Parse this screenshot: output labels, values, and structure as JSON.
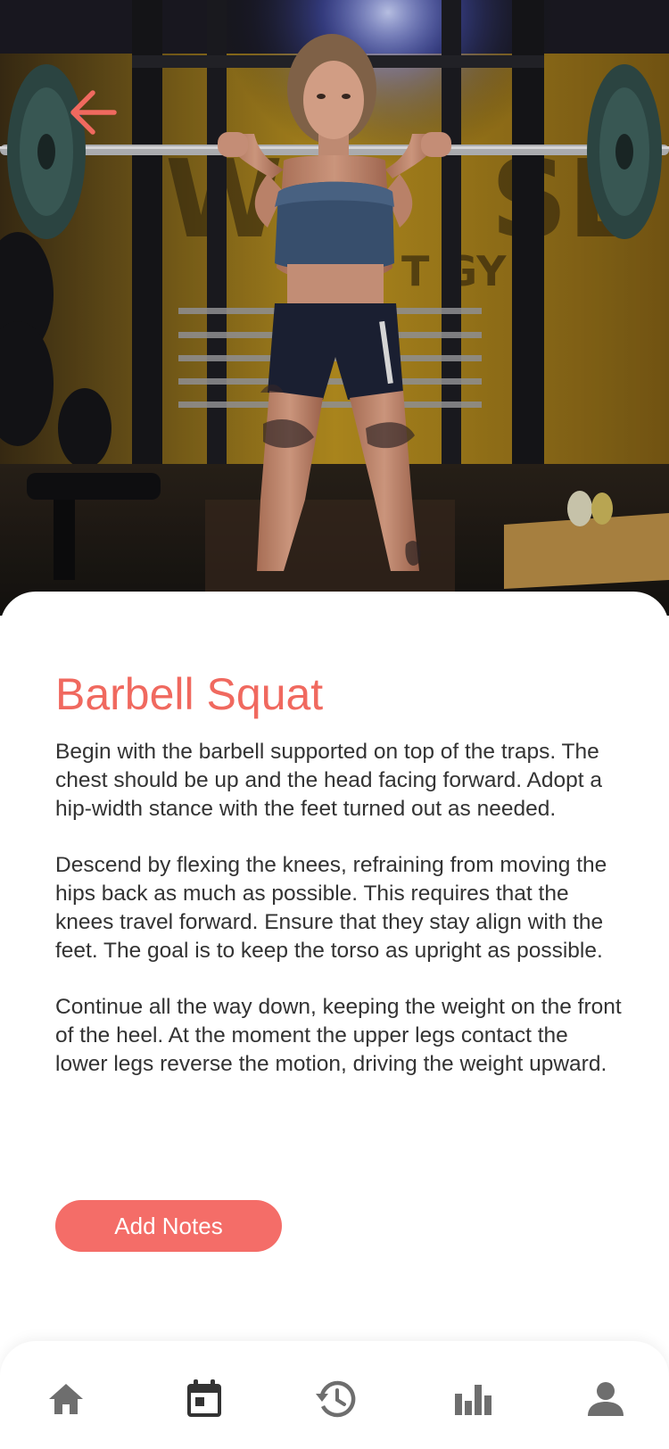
{
  "exercise": {
    "title": "Barbell Squat",
    "paragraphs": [
      "Begin with the barbell supported on top of the traps. The chest should be up and the head facing forward. Adopt a hip-width stance with the feet turned out as needed.",
      "Descend by flexing the knees, refraining from moving the hips back as much as possible. This requires that the knees travel forward. Ensure that they stay align with the feet. The goal is to keep the torso as upright as possible.",
      "Continue all the way down, keeping the weight on the front of the heel. At the moment the upper legs contact the lower legs reverse the motion, driving the weight upward."
    ],
    "add_notes_label": "Add Notes"
  },
  "hero": {
    "back_icon": "arrow-left-icon",
    "image_subject": "athlete-barbell-squat-photo"
  },
  "tabbar": {
    "items": [
      {
        "icon": "home-icon",
        "active": false
      },
      {
        "icon": "calendar-icon",
        "active": true
      },
      {
        "icon": "history-icon",
        "active": false
      },
      {
        "icon": "bar-chart-icon",
        "active": false
      },
      {
        "icon": "user-icon",
        "active": false
      }
    ]
  },
  "colors": {
    "accent": "#f0695f",
    "button": "#f46d68",
    "text": "#333333",
    "icon_inactive": "#6e6e6e",
    "icon_active": "#333333",
    "background": "#ffffff"
  }
}
